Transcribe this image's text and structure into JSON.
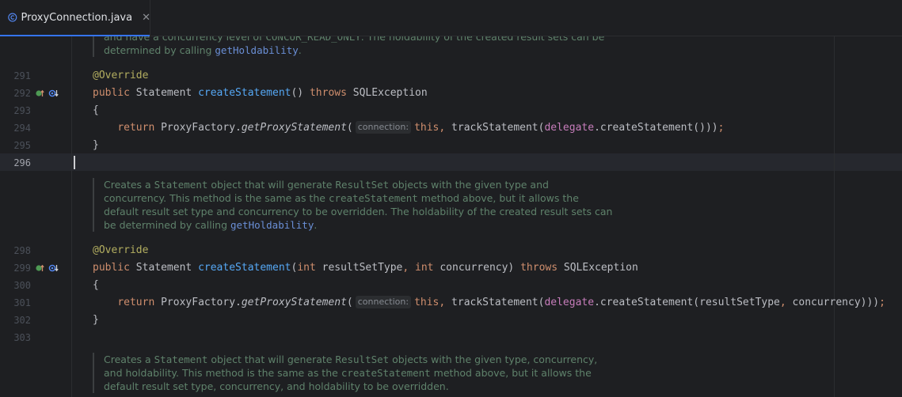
{
  "tab": {
    "filename": "ProxyConnection.java",
    "close_glyph": "✕",
    "icon": "java-class-icon"
  },
  "doc_blocks": [
    {
      "lines": [
        [
          "and have a concurrency level of ",
          "CONCUR_READ_ONLY",
          ". The holdability of the created result sets can be"
        ],
        [
          "determined by calling ",
          "getHoldability",
          "."
        ]
      ]
    },
    {
      "lines": [
        [
          "Creates a ",
          "Statement",
          " object that will generate ",
          "ResultSet",
          " objects with the given type and"
        ],
        [
          "concurrency. This method is the same as the ",
          "createStatement",
          " method above, but it allows the"
        ],
        [
          "default result set type and concurrency to be overridden. The holdability of the created result sets can"
        ],
        [
          "be determined by calling ",
          "getHoldability",
          "."
        ]
      ]
    },
    {
      "lines": [
        [
          "Creates a ",
          "Statement",
          " object that will generate ",
          "ResultSet",
          " objects with the given type, concurrency,"
        ],
        [
          "and holdability. This method is the same as the ",
          "createStatement",
          " method above, but it allows the"
        ],
        [
          "default result set type, concurrency, and holdability to be overridden."
        ]
      ]
    }
  ],
  "lines": [
    {
      "num": "291",
      "tokens": [
        [
          "ann",
          "@Override"
        ]
      ]
    },
    {
      "num": "292",
      "icons": true,
      "tokens": [
        [
          "kw",
          "public "
        ],
        [
          "p",
          "Statement "
        ],
        [
          "fn",
          "createStatement"
        ],
        [
          "p",
          "() "
        ],
        [
          "kw",
          "throws "
        ],
        [
          "p",
          "SQLException"
        ]
      ]
    },
    {
      "num": "293",
      "tokens": [
        [
          "p",
          "{"
        ]
      ]
    },
    {
      "num": "294",
      "tokens": [
        [
          "p",
          "    "
        ],
        [
          "kw",
          "return "
        ],
        [
          "p",
          "ProxyFactory."
        ],
        [
          "it",
          "getProxyStatement"
        ],
        [
          "p",
          "("
        ],
        [
          "hint",
          "connection:"
        ],
        [
          "kw",
          "this"
        ],
        [
          "kw",
          ", "
        ],
        [
          "p",
          "trackStatement("
        ],
        [
          "fld",
          "delegate"
        ],
        [
          "p",
          ".createStatement()))"
        ],
        [
          "kw",
          ";"
        ]
      ]
    },
    {
      "num": "295",
      "tokens": [
        [
          "p",
          "}"
        ]
      ]
    },
    {
      "num": "296",
      "current": true,
      "tokens": []
    },
    {
      "num": "298",
      "tokens": [
        [
          "ann",
          "@Override"
        ]
      ]
    },
    {
      "num": "299",
      "icons": true,
      "tokens": [
        [
          "kw",
          "public "
        ],
        [
          "p",
          "Statement "
        ],
        [
          "fn",
          "createStatement"
        ],
        [
          "p",
          "("
        ],
        [
          "kw",
          "int "
        ],
        [
          "p",
          "resultSetType"
        ],
        [
          "kw",
          ", int "
        ],
        [
          "p",
          "concurrency) "
        ],
        [
          "kw",
          "throws "
        ],
        [
          "p",
          "SQLException"
        ]
      ]
    },
    {
      "num": "300",
      "tokens": [
        [
          "p",
          "{"
        ]
      ]
    },
    {
      "num": "301",
      "tokens": [
        [
          "p",
          "    "
        ],
        [
          "kw",
          "return "
        ],
        [
          "p",
          "ProxyFactory."
        ],
        [
          "it",
          "getProxyStatement"
        ],
        [
          "p",
          "("
        ],
        [
          "hint",
          "connection:"
        ],
        [
          "kw",
          "this"
        ],
        [
          "kw",
          ", "
        ],
        [
          "p",
          "trackStatement("
        ],
        [
          "fld",
          "delegate"
        ],
        [
          "p",
          ".createStatement(resultSetType"
        ],
        [
          "kw",
          ", "
        ],
        [
          "p",
          "concurrency)))"
        ],
        [
          "kw",
          ";"
        ]
      ]
    },
    {
      "num": "302",
      "tokens": [
        [
          "p",
          "}"
        ]
      ]
    },
    {
      "num": "303",
      "tokens": []
    }
  ],
  "gutter_icons": [
    "implementing-method-icon",
    "overriding-method-icon"
  ],
  "colors": {
    "keyword": "#cf8e6d",
    "annotation": "#b3ae60",
    "method": "#56a8f5",
    "field": "#c77dbb",
    "doc": "#5f826b",
    "accent": "#3574f0"
  }
}
